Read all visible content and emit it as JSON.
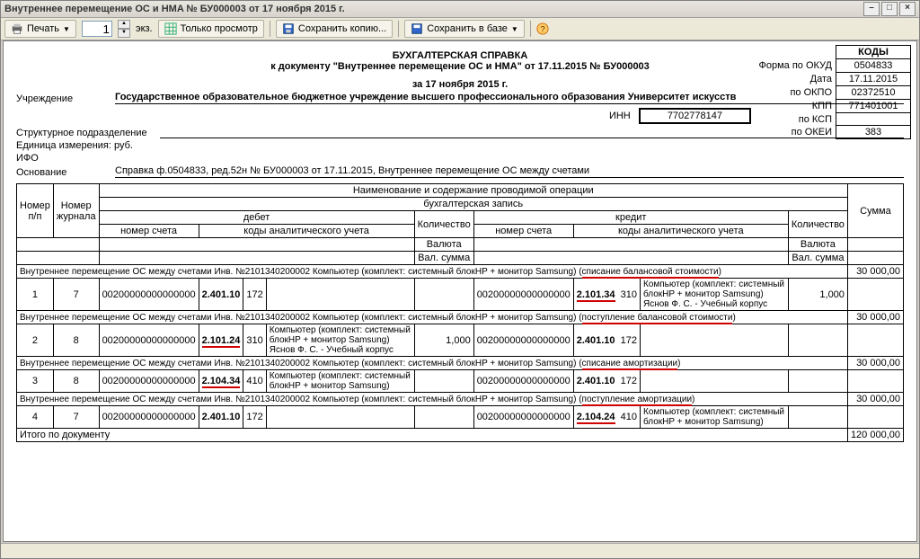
{
  "window": {
    "title": "Внутреннее перемещение ОС и HMA № БУ000003 от 17 ноября 2015 г."
  },
  "toolbar": {
    "print": "Печать",
    "copies": "1",
    "copies_suffix": "экз.",
    "view_only": "Только просмотр",
    "save_copy": "Сохранить копию...",
    "save_db": "Сохранить в базе"
  },
  "doc": {
    "title": "БУХГАЛТЕРСКАЯ СПРАВКА",
    "subtitle": "к документу \"Внутреннее перемещение ОС и НМА\" от 17.11.2015 № БУ000003",
    "date_line": "за 17 ноября 2015 г.",
    "org_label": "Учреждение",
    "org": "Государственное образовательное бюджетное учреждение высшего профессионального образования  Университет искусств",
    "subdiv_label": "Структурное подразделение",
    "unit_label": "Единица измерения: руб.",
    "ifo_label": "ИФО",
    "basis_label": "Основание",
    "basis": "Справка ф.0504833, ред.52н № БУ000003 от 17.11.2015, Внутреннее перемещение ОС между счетами",
    "inn_label": "ИНН",
    "inn": "7702778147",
    "codes": {
      "head": "КОДЫ",
      "okud_l": "Форма по ОКУД",
      "okud": "0504833",
      "date_l": "Дата",
      "date": "17.11.2015",
      "okpo_l": "по ОКПО",
      "okpo": "02372510",
      "kpp_l": "КПП",
      "kpp": "771401001",
      "ksp_l": "по КСП",
      "ksp": "",
      "okei_l": "по ОКЕИ",
      "okei": "383"
    }
  },
  "thead": {
    "op_name": "Наименование и содержание проводимой операции",
    "entry": "бухгалтерская запись",
    "row_no": "Номер п/п",
    "journal": "Номер журнала",
    "debit": "дебет",
    "credit": "кредит",
    "acc_no": "номер счета",
    "analytics": "коды аналитического учета",
    "qty": "Количество",
    "currency": "Валюта",
    "val_sum": "Вал. сумма",
    "sum": "Сумма"
  },
  "groups": [
    {
      "header": "Внутреннее перемещение ОС между счетами Инв. №2101340200002 Компьютер (комплект: системный блокHP + монитор Samsung) (списание балансовой стоимости)",
      "sum": "30 000,00",
      "row_no": "1",
      "journal": "7",
      "d_acc": "00200000000000000",
      "d_code1": "2.401.10",
      "d_code2": "172",
      "d_desc": "",
      "c_acc": "00200000000000000",
      "c_code1": "2.101.34",
      "c_code2": "310",
      "c_desc": "Компьютер (комплект: системный блокHP + монитор Samsung)\nЯснов Ф. С. - Учебный корпус",
      "qty": "1,000",
      "redline_c": true
    },
    {
      "header": "Внутреннее перемещение ОС между счетами Инв. №2101340200002 Компьютер (комплект: системный блокHP + монитор Samsung) (поступление балансовой стоимости)",
      "sum": "30 000,00",
      "row_no": "2",
      "journal": "8",
      "d_acc": "00200000000000000",
      "d_code1": "2.101.24",
      "d_code2": "310",
      "d_desc": "Компьютер (комплект: системный блокHP + монитор Samsung)\nЯснов Ф. С. - Учебный корпус",
      "c_acc": "00200000000000000",
      "c_code1": "2.401.10",
      "c_code2": "172",
      "c_desc": "",
      "qty": "1,000",
      "redline_d": true
    },
    {
      "header": "Внутреннее перемещение ОС между счетами Инв. №2101340200002 Компьютер (комплект: системный блокHP + монитор Samsung) (списание амортизации)",
      "sum": "30 000,00",
      "row_no": "3",
      "journal": "8",
      "d_acc": "00200000000000000",
      "d_code1": "2.104.34",
      "d_code2": "410",
      "d_desc": "Компьютер (комплект: системный блокHP + монитор Samsung)",
      "c_acc": "00200000000000000",
      "c_code1": "2.401.10",
      "c_code2": "172",
      "c_desc": "",
      "qty": "",
      "redline_d": true
    },
    {
      "header": "Внутреннее перемещение ОС между счетами Инв. №2101340200002 Компьютер (комплект: системный блокHP + монитор Samsung) (поступление амортизации)",
      "sum": "30 000,00",
      "row_no": "4",
      "journal": "7",
      "d_acc": "00200000000000000",
      "d_code1": "2.401.10",
      "d_code2": "172",
      "d_desc": "",
      "c_acc": "00200000000000000",
      "c_code1": "2.104.24",
      "c_code2": "410",
      "c_desc": "Компьютер (комплект: системный блокHP + монитор Samsung)",
      "qty": "",
      "redline_c": true
    }
  ],
  "total_label": "Итого по документу",
  "total": "120 000,00"
}
